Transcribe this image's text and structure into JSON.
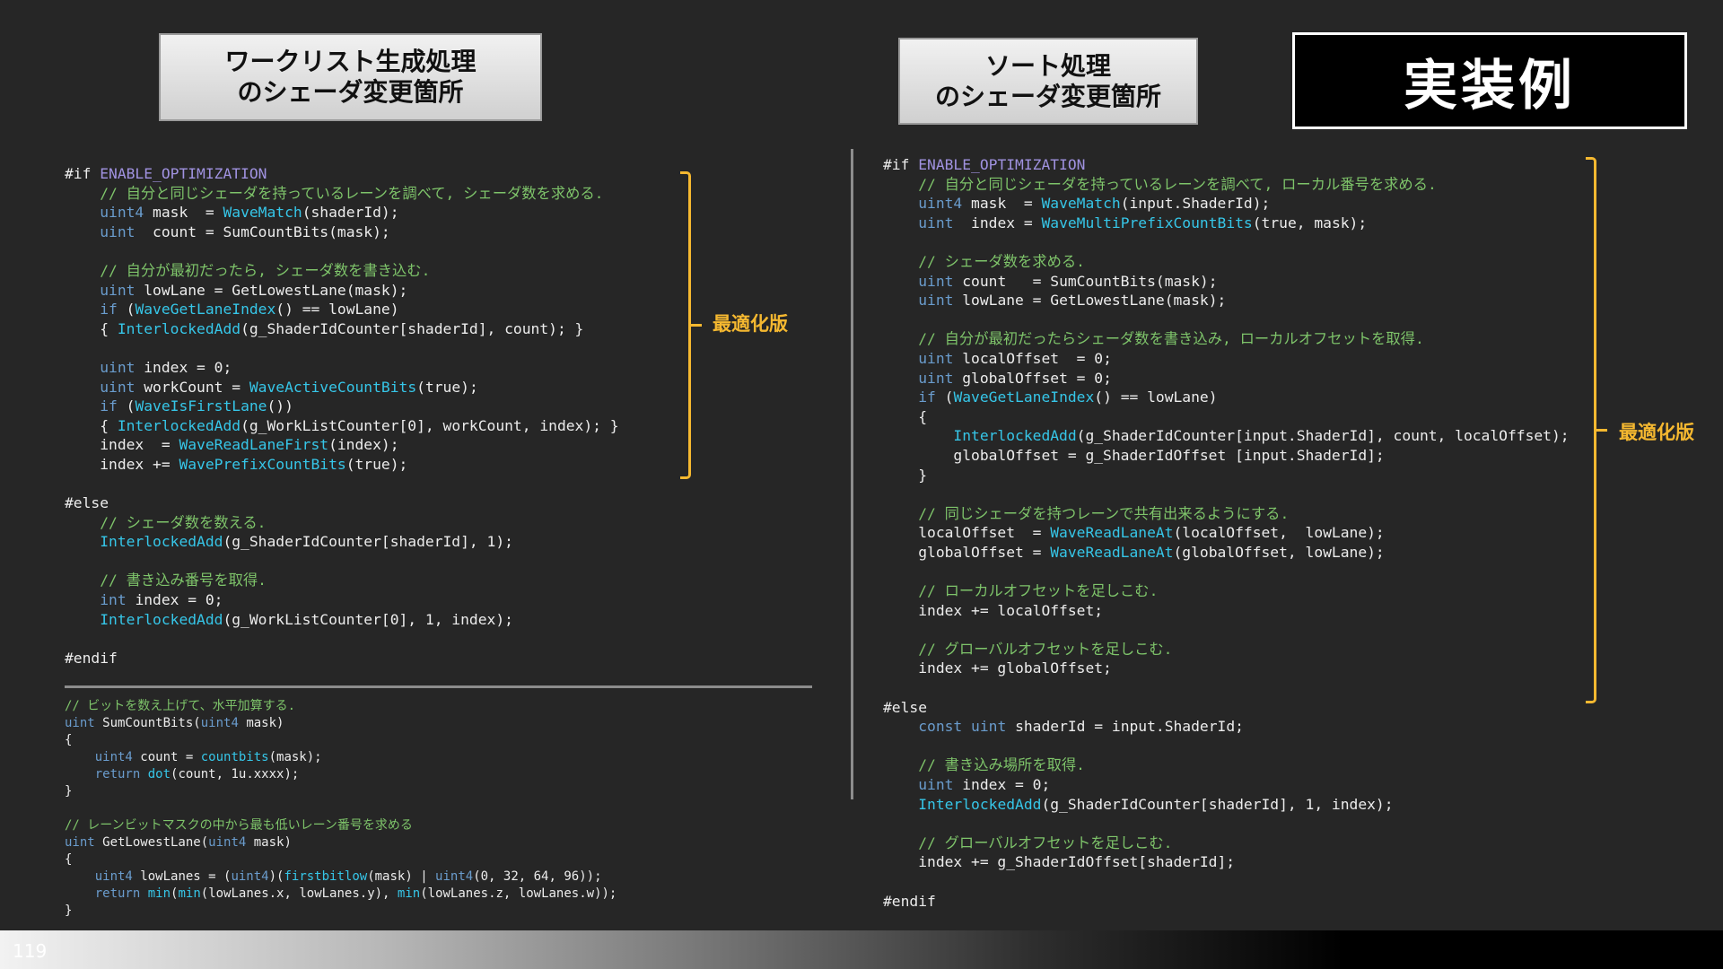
{
  "titles": {
    "left_line1": "ワークリスト生成処理",
    "left_line2": "のシェーダ変更箇所",
    "right_line1": "ソート処理",
    "right_line2": "のシェーダ変更箇所",
    "example": "実装例"
  },
  "labels": {
    "optimization_left": "最適化版",
    "optimization_right": "最適化版"
  },
  "page_number": "119",
  "colors": {
    "background": "#262626",
    "comment": "#7ec46a",
    "keyword": "#6a9ccd",
    "function": "#36c6e8",
    "preprocessor": "#a092e0",
    "bracket": "#f5b830"
  },
  "code": {
    "left": [
      [
        {
          "t": "#if "
        },
        {
          "t": "ENABLE_OPTIMIZATION",
          "c": "pp"
        }
      ],
      [
        {
          "t": "    "
        },
        {
          "t": "// 自分と同じシェーダを持っているレーンを調べて, シェーダ数を求める.",
          "c": "cm"
        }
      ],
      [
        {
          "t": "    "
        },
        {
          "t": "uint4",
          "c": "kw"
        },
        {
          "t": " mask  = "
        },
        {
          "t": "WaveMatch",
          "c": "fn"
        },
        {
          "t": "(shaderId);"
        }
      ],
      [
        {
          "t": "    "
        },
        {
          "t": "uint",
          "c": "kw"
        },
        {
          "t": "  count = SumCountBits(mask);"
        }
      ],
      [],
      [
        {
          "t": "    "
        },
        {
          "t": "// 自分が最初だったら, シェーダ数を書き込む.",
          "c": "cm"
        }
      ],
      [
        {
          "t": "    "
        },
        {
          "t": "uint",
          "c": "kw"
        },
        {
          "t": " lowLane = GetLowestLane(mask);"
        }
      ],
      [
        {
          "t": "    "
        },
        {
          "t": "if",
          "c": "kw"
        },
        {
          "t": " ("
        },
        {
          "t": "WaveGetLaneIndex",
          "c": "fn"
        },
        {
          "t": "() == lowLane)"
        }
      ],
      [
        {
          "t": "    { "
        },
        {
          "t": "InterlockedAdd",
          "c": "fn"
        },
        {
          "t": "(g_ShaderIdCounter[shaderId], count); }"
        }
      ],
      [],
      [
        {
          "t": "    "
        },
        {
          "t": "uint",
          "c": "kw"
        },
        {
          "t": " index = 0;"
        }
      ],
      [
        {
          "t": "    "
        },
        {
          "t": "uint",
          "c": "kw"
        },
        {
          "t": " workCount = "
        },
        {
          "t": "WaveActiveCountBits",
          "c": "fn"
        },
        {
          "t": "(true);"
        }
      ],
      [
        {
          "t": "    "
        },
        {
          "t": "if",
          "c": "kw"
        },
        {
          "t": " ("
        },
        {
          "t": "WaveIsFirstLane",
          "c": "fn"
        },
        {
          "t": "())"
        }
      ],
      [
        {
          "t": "    { "
        },
        {
          "t": "InterlockedAdd",
          "c": "fn"
        },
        {
          "t": "(g_WorkListCounter[0], workCount, index); }"
        }
      ],
      [
        {
          "t": "    index  = "
        },
        {
          "t": "WaveReadLaneFirst",
          "c": "fn"
        },
        {
          "t": "(index);"
        }
      ],
      [
        {
          "t": "    index += "
        },
        {
          "t": "WavePrefixCountBits",
          "c": "fn"
        },
        {
          "t": "(true);"
        }
      ],
      [],
      [
        {
          "t": "#else"
        }
      ],
      [
        {
          "t": "    "
        },
        {
          "t": "// シェーダ数を数える.",
          "c": "cm"
        }
      ],
      [
        {
          "t": "    "
        },
        {
          "t": "InterlockedAdd",
          "c": "fn"
        },
        {
          "t": "(g_ShaderIdCounter[shaderId], 1);"
        }
      ],
      [],
      [
        {
          "t": "    "
        },
        {
          "t": "// 書き込み番号を取得.",
          "c": "cm"
        }
      ],
      [
        {
          "t": "    "
        },
        {
          "t": "int",
          "c": "kw"
        },
        {
          "t": " index = 0;"
        }
      ],
      [
        {
          "t": "    "
        },
        {
          "t": "InterlockedAdd",
          "c": "fn"
        },
        {
          "t": "(g_WorkListCounter[0], 1, index);"
        }
      ],
      [],
      [
        {
          "t": "#endif"
        }
      ]
    ],
    "util": [
      [
        {
          "t": "// ビットを数え上げて、水平加算する.",
          "c": "cm"
        }
      ],
      [
        {
          "t": "uint",
          "c": "kw"
        },
        {
          "t": " SumCountBits("
        },
        {
          "t": "uint4",
          "c": "kw"
        },
        {
          "t": " mask)"
        }
      ],
      [
        {
          "t": "{"
        }
      ],
      [
        {
          "t": "    "
        },
        {
          "t": "uint4",
          "c": "kw"
        },
        {
          "t": " count = "
        },
        {
          "t": "countbits",
          "c": "fn"
        },
        {
          "t": "(mask);"
        }
      ],
      [
        {
          "t": "    "
        },
        {
          "t": "return",
          "c": "kw"
        },
        {
          "t": " "
        },
        {
          "t": "dot",
          "c": "fn"
        },
        {
          "t": "(count, 1u.xxxx);"
        }
      ],
      [
        {
          "t": "}"
        }
      ],
      [],
      [
        {
          "t": "// レーンビットマスクの中から最も低いレーン番号を求める",
          "c": "cm"
        }
      ],
      [
        {
          "t": "uint",
          "c": "kw"
        },
        {
          "t": " GetLowestLane("
        },
        {
          "t": "uint4",
          "c": "kw"
        },
        {
          "t": " mask)"
        }
      ],
      [
        {
          "t": "{"
        }
      ],
      [
        {
          "t": "    "
        },
        {
          "t": "uint4",
          "c": "kw"
        },
        {
          "t": " lowLanes = ("
        },
        {
          "t": "uint4",
          "c": "kw"
        },
        {
          "t": ")("
        },
        {
          "t": "firstbitlow",
          "c": "fn"
        },
        {
          "t": "(mask) | "
        },
        {
          "t": "uint4",
          "c": "kw"
        },
        {
          "t": "(0, 32, 64, 96));"
        }
      ],
      [
        {
          "t": "    "
        },
        {
          "t": "return",
          "c": "kw"
        },
        {
          "t": " "
        },
        {
          "t": "min",
          "c": "fn"
        },
        {
          "t": "("
        },
        {
          "t": "min",
          "c": "fn"
        },
        {
          "t": "(lowLanes.x, lowLanes.y), "
        },
        {
          "t": "min",
          "c": "fn"
        },
        {
          "t": "(lowLanes.z, lowLanes.w));"
        }
      ],
      [
        {
          "t": "}"
        }
      ]
    ],
    "right": [
      [
        {
          "t": "#if "
        },
        {
          "t": "ENABLE_OPTIMIZATION",
          "c": "pp"
        }
      ],
      [
        {
          "t": "    "
        },
        {
          "t": "// 自分と同じシェーダを持っているレーンを調べて, ローカル番号を求める.",
          "c": "cm"
        }
      ],
      [
        {
          "t": "    "
        },
        {
          "t": "uint4",
          "c": "kw"
        },
        {
          "t": " mask  = "
        },
        {
          "t": "WaveMatch",
          "c": "fn"
        },
        {
          "t": "(input.ShaderId);"
        }
      ],
      [
        {
          "t": "    "
        },
        {
          "t": "uint",
          "c": "kw"
        },
        {
          "t": "  index = "
        },
        {
          "t": "WaveMultiPrefixCountBits",
          "c": "fn"
        },
        {
          "t": "(true, mask);"
        }
      ],
      [],
      [
        {
          "t": "    "
        },
        {
          "t": "// シェーダ数を求める.",
          "c": "cm"
        }
      ],
      [
        {
          "t": "    "
        },
        {
          "t": "uint",
          "c": "kw"
        },
        {
          "t": " count   = SumCountBits(mask);"
        }
      ],
      [
        {
          "t": "    "
        },
        {
          "t": "uint",
          "c": "kw"
        },
        {
          "t": " lowLane = GetLowestLane(mask);"
        }
      ],
      [],
      [
        {
          "t": "    "
        },
        {
          "t": "// 自分が最初だったらシェーダ数を書き込み, ローカルオフセットを取得.",
          "c": "cm"
        }
      ],
      [
        {
          "t": "    "
        },
        {
          "t": "uint",
          "c": "kw"
        },
        {
          "t": " localOffset  = 0;"
        }
      ],
      [
        {
          "t": "    "
        },
        {
          "t": "uint",
          "c": "kw"
        },
        {
          "t": " globalOffset = 0;"
        }
      ],
      [
        {
          "t": "    "
        },
        {
          "t": "if",
          "c": "kw"
        },
        {
          "t": " ("
        },
        {
          "t": "WaveGetLaneIndex",
          "c": "fn"
        },
        {
          "t": "() == lowLane)"
        }
      ],
      [
        {
          "t": "    {"
        }
      ],
      [
        {
          "t": "        "
        },
        {
          "t": "InterlockedAdd",
          "c": "fn"
        },
        {
          "t": "(g_ShaderIdCounter[input.ShaderId], count, localOffset);"
        }
      ],
      [
        {
          "t": "        globalOffset = g_ShaderIdOffset [input.ShaderId];"
        }
      ],
      [
        {
          "t": "    }"
        }
      ],
      [],
      [
        {
          "t": "    "
        },
        {
          "t": "// 同じシェーダを持つレーンで共有出来るようにする.",
          "c": "cm"
        }
      ],
      [
        {
          "t": "    localOffset  = "
        },
        {
          "t": "WaveReadLaneAt",
          "c": "fn"
        },
        {
          "t": "(localOffset,  lowLane);"
        }
      ],
      [
        {
          "t": "    globalOffset = "
        },
        {
          "t": "WaveReadLaneAt",
          "c": "fn"
        },
        {
          "t": "(globalOffset, lowLane);"
        }
      ],
      [],
      [
        {
          "t": "    "
        },
        {
          "t": "// ローカルオフセットを足しこむ.",
          "c": "cm"
        }
      ],
      [
        {
          "t": "    index += localOffset;"
        }
      ],
      [],
      [
        {
          "t": "    "
        },
        {
          "t": "// グローバルオフセットを足しこむ.",
          "c": "cm"
        }
      ],
      [
        {
          "t": "    index += globalOffset;"
        }
      ],
      [],
      [
        {
          "t": "#else"
        }
      ],
      [
        {
          "t": "    "
        },
        {
          "t": "const",
          "c": "kw"
        },
        {
          "t": " "
        },
        {
          "t": "uint",
          "c": "kw"
        },
        {
          "t": " shaderId = input.ShaderId;"
        }
      ],
      [],
      [
        {
          "t": "    "
        },
        {
          "t": "// 書き込み場所を取得.",
          "c": "cm"
        }
      ],
      [
        {
          "t": "    "
        },
        {
          "t": "uint",
          "c": "kw"
        },
        {
          "t": " index = 0;"
        }
      ],
      [
        {
          "t": "    "
        },
        {
          "t": "InterlockedAdd",
          "c": "fn"
        },
        {
          "t": "(g_ShaderIdCounter[shaderId], 1, index);"
        }
      ],
      [],
      [
        {
          "t": "    "
        },
        {
          "t": "// グローバルオフセットを足しこむ.",
          "c": "cm"
        }
      ],
      [
        {
          "t": "    index += g_ShaderIdOffset[shaderId];"
        }
      ],
      [],
      [
        {
          "t": "#endif"
        }
      ]
    ]
  }
}
